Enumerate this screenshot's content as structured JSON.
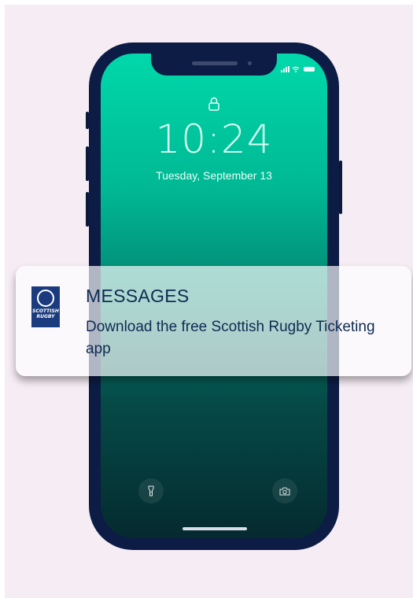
{
  "lock_screen": {
    "time": "10:24",
    "date": "Tuesday, September 13"
  },
  "icons": {
    "lock": "lock-icon",
    "flashlight": "flashlight-icon",
    "camera": "camera-icon"
  },
  "notification": {
    "app_logo_text": "SCOTTISH RUGBY",
    "title": "MESSAGES",
    "body": "Download the free Scottish Rugby Ticketing app"
  },
  "colors": {
    "background": "#f6edf4",
    "phone_frame": "#0c1c44",
    "screen_top": "#00d8aa",
    "screen_bottom": "#052a2f",
    "notification_text": "#0f2b52",
    "logo_blue": "#1a3b7d"
  }
}
